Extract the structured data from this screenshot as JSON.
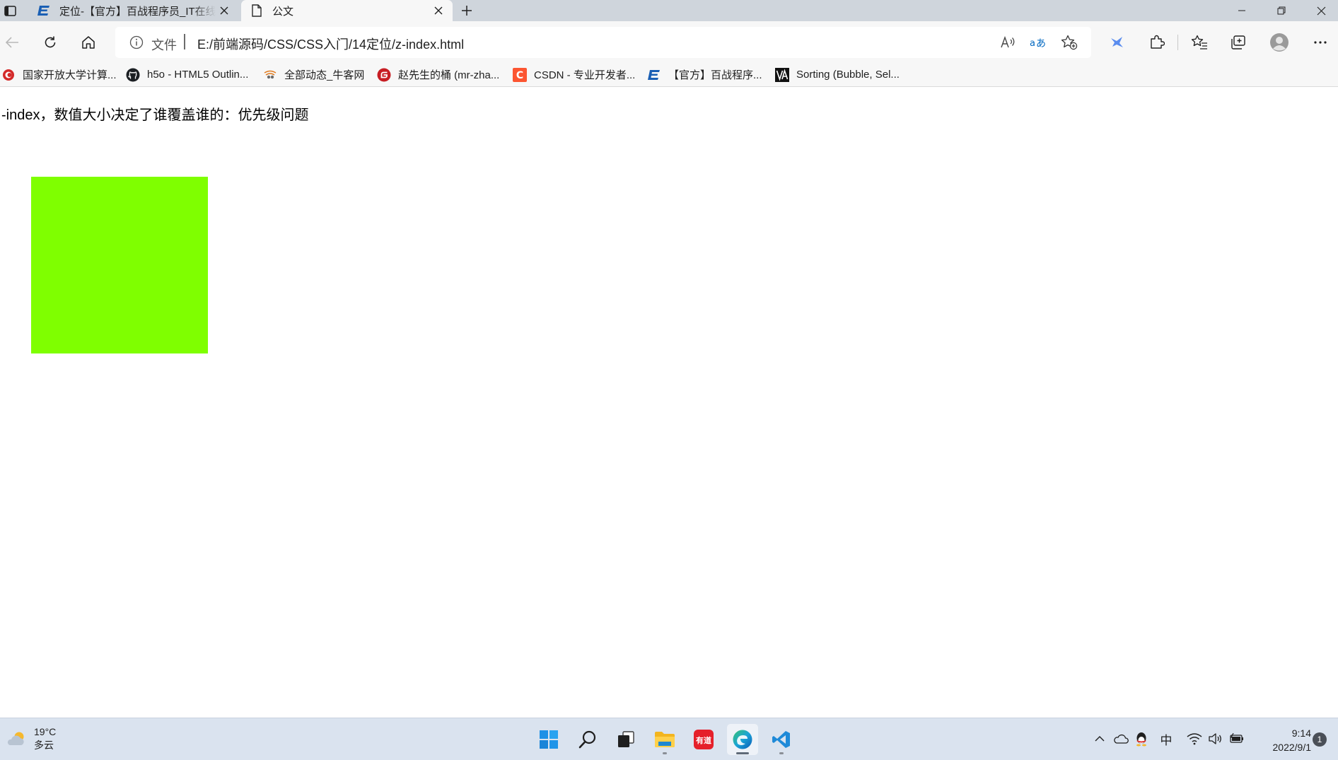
{
  "browser": {
    "tabs": [
      {
        "title": "定位-【官方】百战程序员_IT在线",
        "favicon": "bjsxt-logo-icon",
        "active": false
      },
      {
        "title": "公文",
        "favicon": "document-icon",
        "active": true
      }
    ],
    "address": {
      "scheme_label": "文件",
      "url": "E:/前端源码/CSS/CSS入门/14定位/z-index.html"
    },
    "favorites": [
      {
        "label": "国家开放大学计算...",
        "icon": "ouchn-logo-icon"
      },
      {
        "label": "h5o - HTML5 Outlin...",
        "icon": "github-icon"
      },
      {
        "label": "全部动态_牛客网",
        "icon": "nowcoder-icon"
      },
      {
        "label": "赵先生的桶 (mr-zha...",
        "icon": "gitee-icon"
      },
      {
        "label": "CSDN - 专业开发者...",
        "icon": "csdn-icon"
      },
      {
        "label": "【官方】百战程序...",
        "icon": "bjsxt-logo-icon"
      },
      {
        "label": "Sorting (Bubble, Sel...",
        "icon": "visualgo-icon"
      }
    ]
  },
  "page": {
    "text": "-index，数值大小决定了谁覆盖谁的：优先级问题",
    "box_color": "#7fff00"
  },
  "taskbar": {
    "weather": {
      "temp": "19°C",
      "condition": "多云"
    },
    "ime": "中",
    "time": "9:14",
    "date": "2022/9/1",
    "notifications": "1"
  },
  "colors": {
    "tabstrip": "#cfd5dc",
    "toolbar": "#f7f7f7",
    "taskbar": "#dae3ef",
    "accent": "#0067c0"
  }
}
